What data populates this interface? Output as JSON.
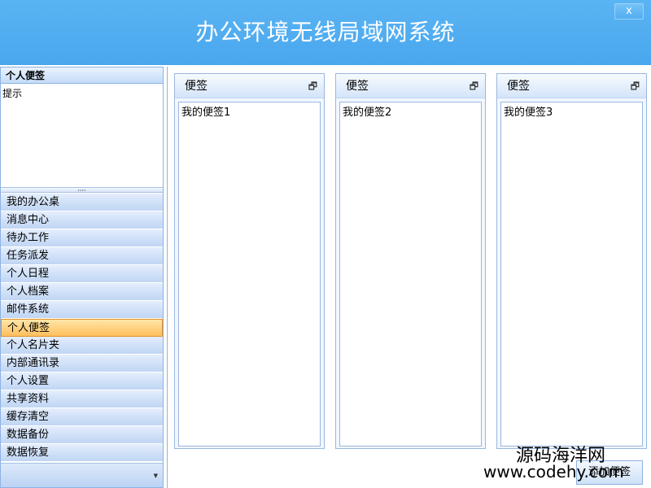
{
  "window": {
    "title": "办公环境无线局域网系统",
    "close_label": "x"
  },
  "sidebar": {
    "panel_title": "个人便签",
    "panel_content": "提示",
    "splitter_grip": ",,,,",
    "menu_items": [
      "我的办公桌",
      "消息中心",
      "待办工作",
      "任务派发",
      "个人日程",
      "个人档案",
      "邮件系统",
      "个人便签",
      "个人名片夹",
      "内部通讯录",
      "个人设置",
      "共享资料",
      "缓存清空",
      "数据备份",
      "数据恢复"
    ],
    "active_item": "个人便签"
  },
  "notes": [
    {
      "title": "便签",
      "content": "我的便签1"
    },
    {
      "title": "便签",
      "content": "我的便签2"
    },
    {
      "title": "便签",
      "content": "我的便签3"
    }
  ],
  "footer": {
    "button_label": "添加便签"
  },
  "watermark": {
    "line1": "源码海洋网",
    "line2": "www.codehy.com"
  }
}
